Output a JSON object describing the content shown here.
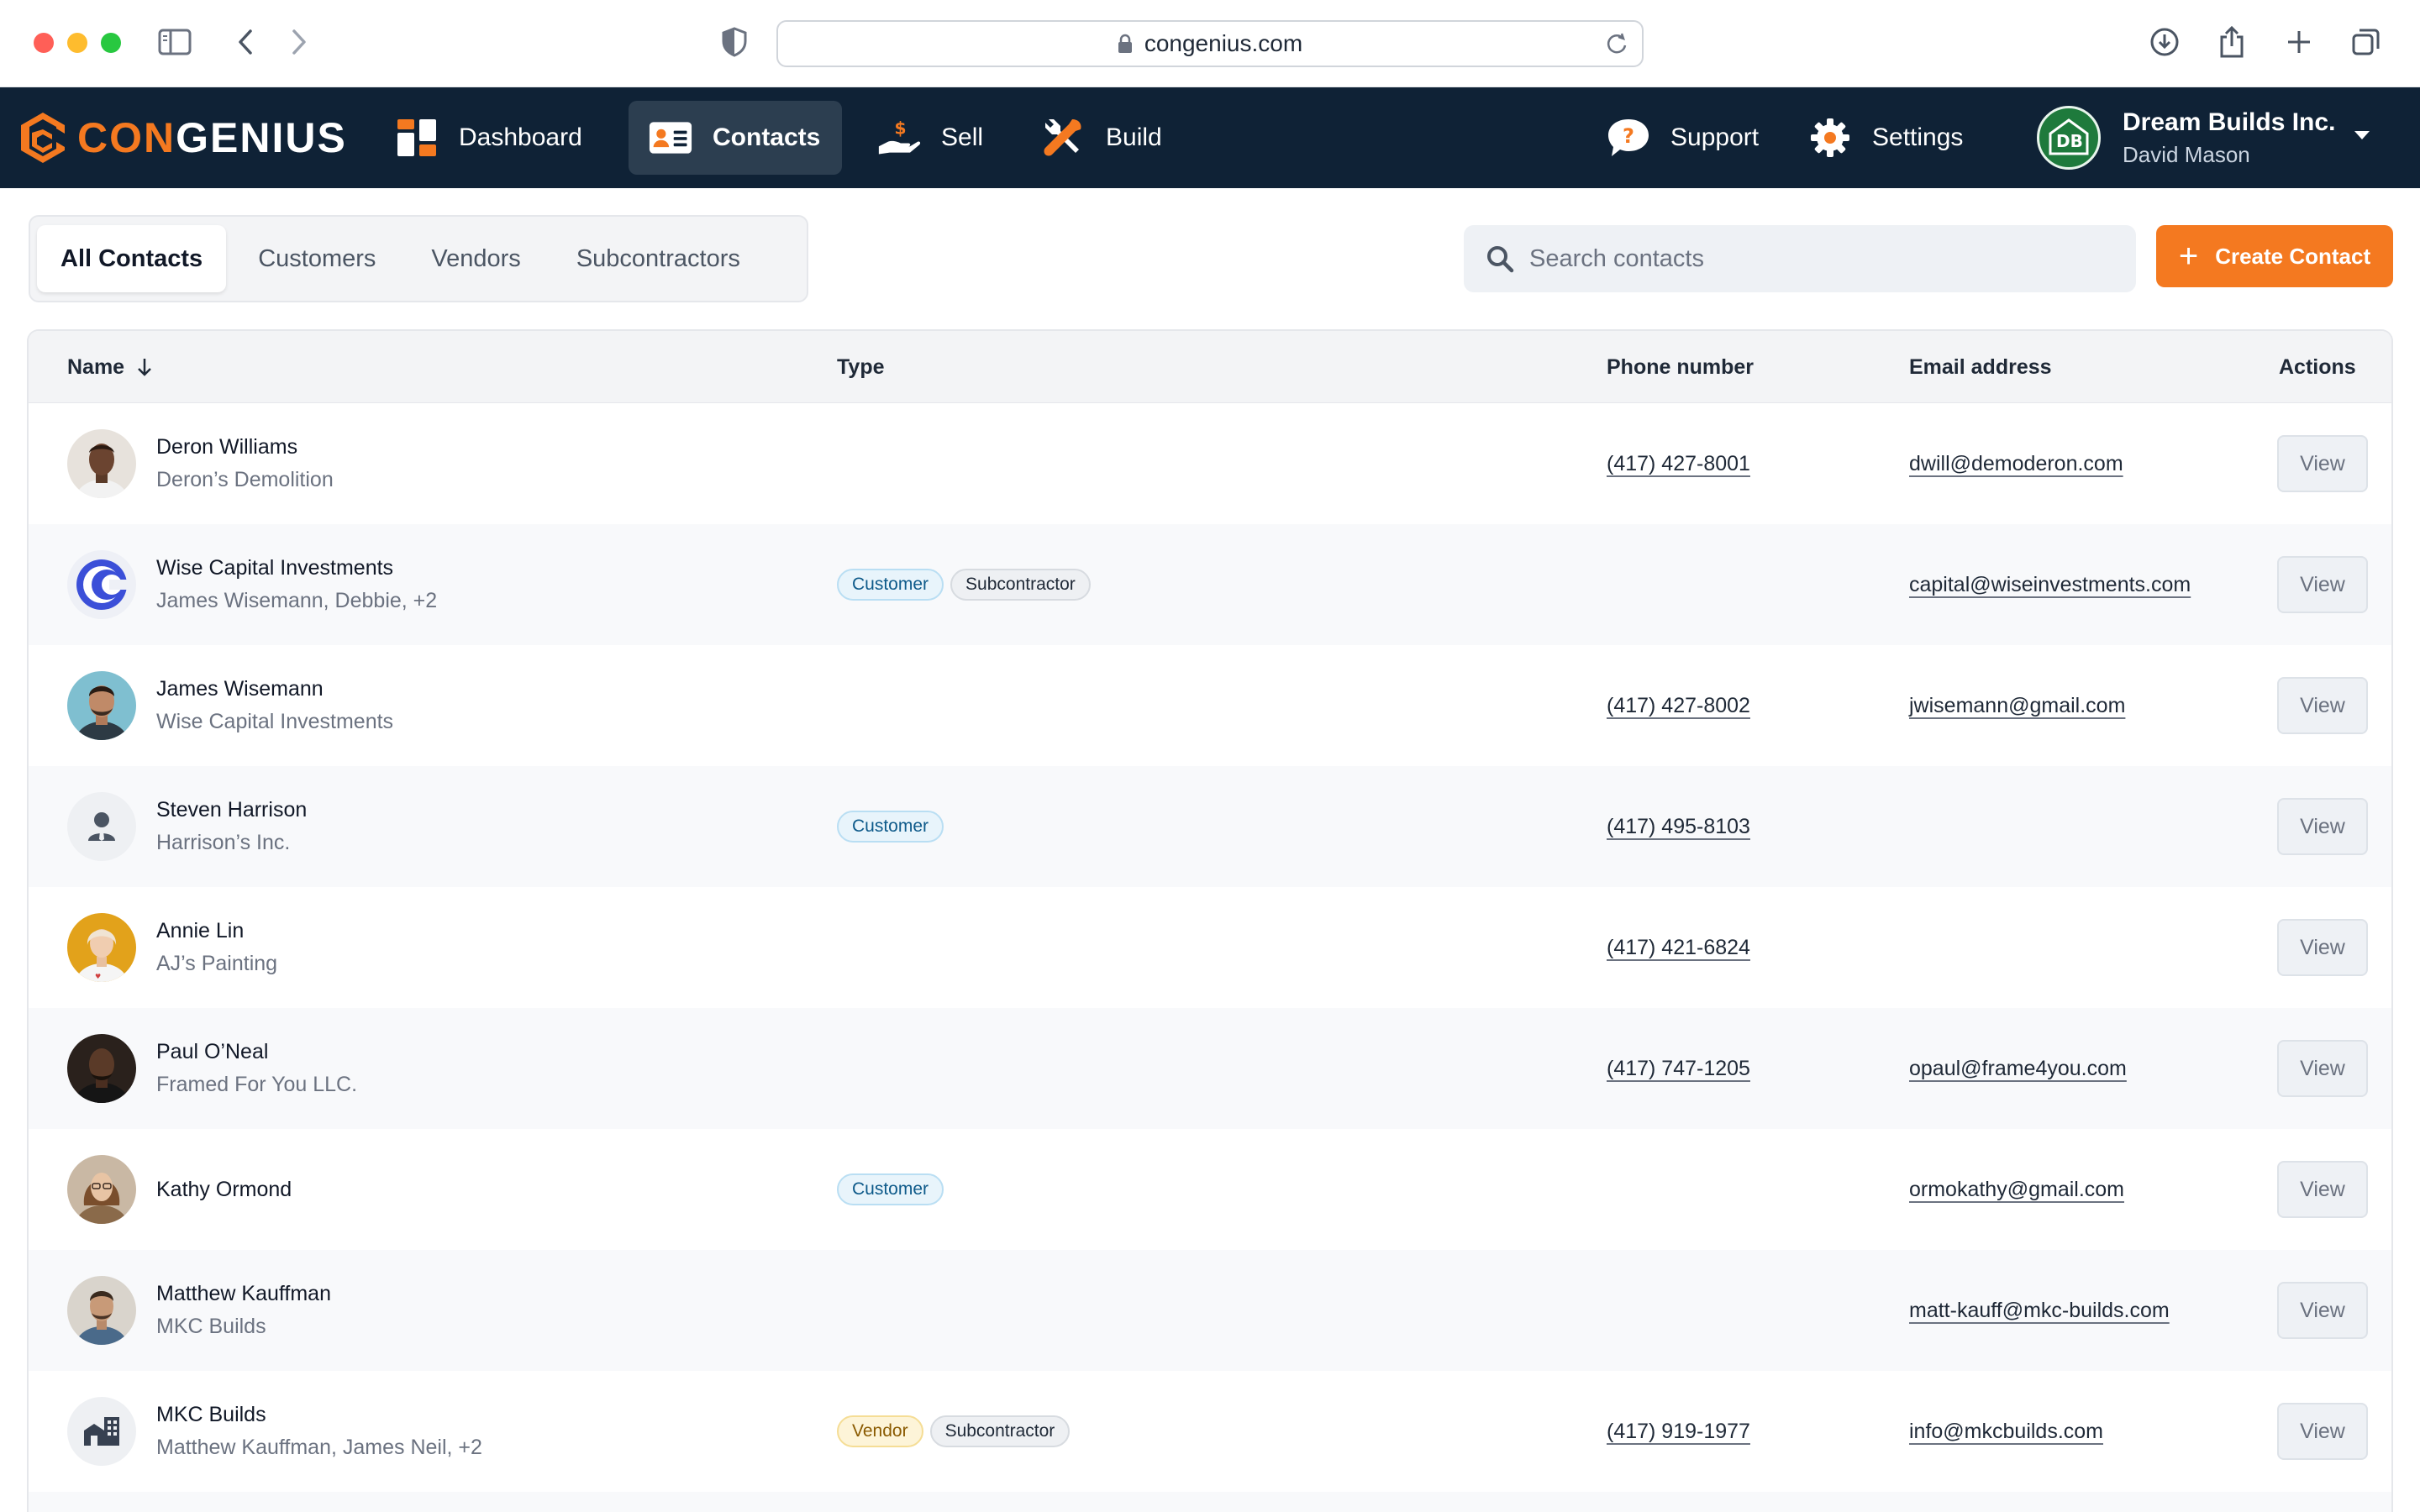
{
  "browser": {
    "url": "congenius.com"
  },
  "app": {
    "logo_con": "CON",
    "logo_genius": "GENIUS",
    "nav": {
      "dashboard": "Dashboard",
      "contacts": "Contacts",
      "sell": "Sell",
      "build": "Build",
      "support": "Support",
      "settings": "Settings"
    },
    "account": {
      "company": "Dream Builds Inc.",
      "user": "David Mason"
    },
    "brand_color": "#f47920",
    "nav_bg": "#0f2236"
  },
  "tabs": [
    "All Contacts",
    "Customers",
    "Vendors",
    "Subcontractors"
  ],
  "active_tab": "All Contacts",
  "search": {
    "placeholder": "Search contacts"
  },
  "create_button": "Create Contact",
  "table": {
    "headers": {
      "name": "Name",
      "type": "Type",
      "phone": "Phone number",
      "email": "Email address",
      "actions": "Actions"
    },
    "sort_column": "Name",
    "sort_direction": "descending",
    "rows": [
      {
        "name": "Deron Williams",
        "sub": "Deron’s Demolition",
        "types": [],
        "phone": "(417) 427-8001",
        "email": "dwill@demoderon.com",
        "action": "View",
        "avatar": "photo"
      },
      {
        "name": "Wise Capital Investments",
        "sub": "James Wisemann, Debbie, +2",
        "types": [
          "Customer",
          "Subcontractor"
        ],
        "phone": "",
        "email": "capital@wiseinvestments.com",
        "action": "View",
        "avatar": "company-logo"
      },
      {
        "name": "James Wisemann",
        "sub": "Wise Capital Investments",
        "types": [],
        "phone": "(417) 427-8002",
        "email": "jwisemann@gmail.com",
        "action": "View",
        "avatar": "photo"
      },
      {
        "name": "Steven Harrison",
        "sub": "Harrison’s Inc.",
        "types": [
          "Customer"
        ],
        "phone": "(417) 495-8103",
        "email": "",
        "action": "View",
        "avatar": "person-placeholder"
      },
      {
        "name": "Annie Lin",
        "sub": "AJ’s Painting",
        "types": [],
        "phone": "(417) 421-6824",
        "email": "",
        "action": "View",
        "avatar": "photo"
      },
      {
        "name": "Paul O’Neal",
        "sub": "Framed For You LLC.",
        "types": [],
        "phone": "(417) 747-1205",
        "email": "opaul@frame4you.com",
        "action": "View",
        "avatar": "photo"
      },
      {
        "name": "Kathy Ormond",
        "sub": "",
        "types": [
          "Customer"
        ],
        "phone": "",
        "email": "ormokathy@gmail.com",
        "action": "View",
        "avatar": "photo"
      },
      {
        "name": "Matthew Kauffman",
        "sub": "MKC Builds",
        "types": [],
        "phone": "",
        "email": "matt-kauff@mkc-builds.com",
        "action": "View",
        "avatar": "photo"
      },
      {
        "name": "MKC Builds",
        "sub": "Matthew Kauffman, James Neil, +2",
        "types": [
          "Vendor",
          "Subcontractor"
        ],
        "phone": "(417) 919-1977",
        "email": "info@mkcbuilds.com",
        "action": "View",
        "avatar": "building-placeholder"
      }
    ]
  }
}
